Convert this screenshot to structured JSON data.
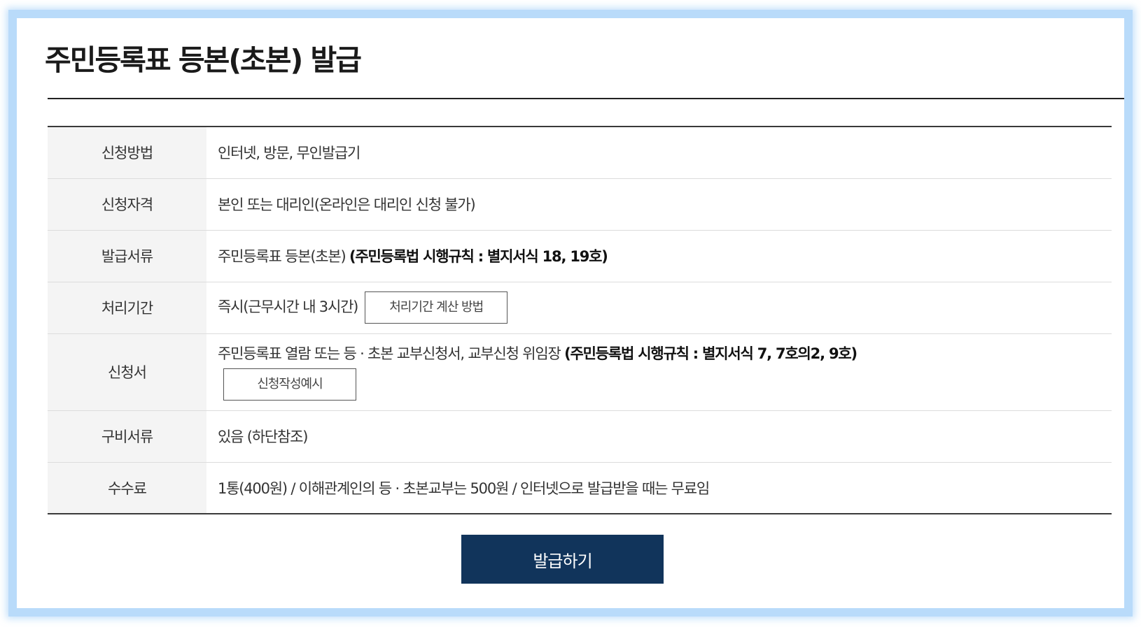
{
  "page": {
    "title": "주민등록표 등본(초본) 발급"
  },
  "rows": [
    {
      "label": "신청방법",
      "value": "인터넷, 방문, 무인발급기"
    },
    {
      "label": "신청자격",
      "value": "본인 또는 대리인(온라인은 대리인 신청 불가)"
    },
    {
      "label": "발급서류",
      "value": "주민등록표 등본(초본) ",
      "value_bold": "(주민등록법 시행규칙 : 별지서식 18, 19호)"
    },
    {
      "label": "처리기간",
      "value": "즉시(근무시간 내 3시간)",
      "button": "처리기간 계산 방법"
    },
    {
      "label": "신청서",
      "value": "주민등록표 열람 또는 등 · 초본 교부신청서, 교부신청 위임장 ",
      "value_bold": "(주민등록법 시행규칙 : 별지서식 7, 7호의2, 9호)",
      "button": "신청작성예시"
    },
    {
      "label": "구비서류",
      "value": "있음 (하단참조)"
    },
    {
      "label": "수수료",
      "value": "1통(400원) / 이해관계인의 등 · 초본교부는 500원 / 인터넷으로 발급받을 때는 무료임"
    }
  ],
  "actions": {
    "issue_label": "발급하기"
  },
  "colors": {
    "frame_border": "#b9dbfa",
    "primary_button": "#11345b",
    "header_cell_bg": "#f4f4f4"
  }
}
